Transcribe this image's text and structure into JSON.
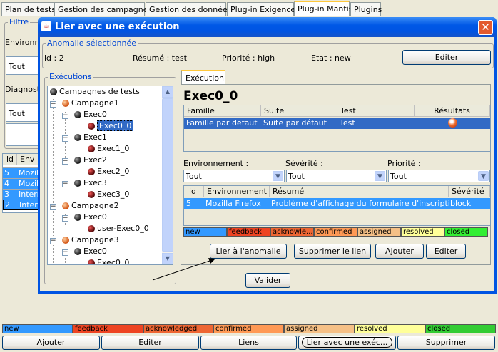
{
  "main_tabs": [
    {
      "label": "Plan de tests"
    },
    {
      "label": "Gestion des campagnes"
    },
    {
      "label": "Gestion des données"
    },
    {
      "label": "Plug-in Exigences"
    },
    {
      "label": "Plug-in Mantis"
    },
    {
      "label": "Plugins"
    }
  ],
  "background": {
    "filter_title": "Filtre",
    "env_label": "Environne",
    "env_value": "Tout",
    "diag_label": "Diagnostic",
    "diag_value": "Tout",
    "table_headers": [
      "id",
      "Env"
    ],
    "rows": [
      {
        "id": "5",
        "env": "Mozill"
      },
      {
        "id": "4",
        "env": "Mozill"
      },
      {
        "id": "3",
        "env": "Intern"
      },
      {
        "id": "2",
        "env": "Intern"
      }
    ],
    "statuses": [
      {
        "label": "new",
        "color": "#3399ff"
      },
      {
        "label": "feedback",
        "color": "#ee4422"
      },
      {
        "label": "acknowledged",
        "color": "#ee6633"
      },
      {
        "label": "confirmed",
        "color": "#ff9955"
      },
      {
        "label": "assigned",
        "color": "#f5c086"
      },
      {
        "label": "resolved",
        "color": "#ffff99"
      },
      {
        "label": "closed",
        "color": "#33cc33"
      }
    ],
    "buttons": {
      "add": "Ajouter",
      "edit": "Editer",
      "links": "Liens",
      "link_exec": "Lier avec une exéc...",
      "delete": "Supprimer"
    }
  },
  "dialog": {
    "title": "Lier avec une exécution",
    "anomaly_group": "Anomalie sélectionnée",
    "anomaly": {
      "id": "id : 2",
      "resume": "Résumé : test",
      "priority": "Priorité : high",
      "state": "Etat : new"
    },
    "edit_button": "Editer",
    "executions_group": "Exécutions",
    "tree": [
      {
        "label": "Campagnes de tests",
        "icon": "dark"
      },
      {
        "label": "Campagne1",
        "icon": "orange"
      },
      {
        "label": "Exec0",
        "icon": "dark"
      },
      {
        "label": "Exec0_0",
        "icon": "exec",
        "selected": true
      },
      {
        "label": "Exec1",
        "icon": "dark"
      },
      {
        "label": "Exec1_0",
        "icon": "exec"
      },
      {
        "label": "Exec2",
        "icon": "dark"
      },
      {
        "label": "Exec2_0",
        "icon": "exec"
      },
      {
        "label": "Exec3",
        "icon": "dark"
      },
      {
        "label": "Exec3_0",
        "icon": "exec"
      },
      {
        "label": "Campagne2",
        "icon": "orange"
      },
      {
        "label": "Exec0",
        "icon": "dark"
      },
      {
        "label": "user-Exec0_0",
        "icon": "exec"
      },
      {
        "label": "Campagne3",
        "icon": "orange"
      },
      {
        "label": "Exec0",
        "icon": "dark"
      },
      {
        "label": "Exec0_0",
        "icon": "exec"
      }
    ],
    "exec_tab": "Exécution",
    "exec_name": "Exec0_0",
    "results_headers": [
      "Famille",
      "Suite",
      "Test",
      "Résultats"
    ],
    "results_row": {
      "famille": "Famille par defaut",
      "suite": "Suite par défaut",
      "test": "Test"
    },
    "env_label": "Environnement :",
    "sev_label": "Sévérité :",
    "prio_label": "Priorité :",
    "env_value": "Tout",
    "sev_value": "Tout",
    "prio_value": "Tout",
    "anomalies_headers": [
      "id",
      "Environnement",
      "Résumé",
      "Sévérité"
    ],
    "anomalies_row": {
      "id": "5",
      "env": "Mozilla Firefox",
      "resume": "Problème d'affichage du formulaire d'inscription",
      "sev": "block"
    },
    "statuses": [
      {
        "label": "new",
        "color": "#3399ff"
      },
      {
        "label": "feedback",
        "color": "#ee4422"
      },
      {
        "label": "acknowle...",
        "color": "#ee6633"
      },
      {
        "label": "confirmed",
        "color": "#ff9955"
      },
      {
        "label": "assigned",
        "color": "#f5c086"
      },
      {
        "label": "resolved",
        "color": "#ffff99"
      },
      {
        "label": "closed",
        "color": "#33ee33"
      }
    ],
    "buttons": {
      "link": "Lier à l'anomalie",
      "unlink": "Supprimer le lien",
      "add": "Ajouter",
      "edit": "Editer",
      "validate": "Valider"
    }
  }
}
